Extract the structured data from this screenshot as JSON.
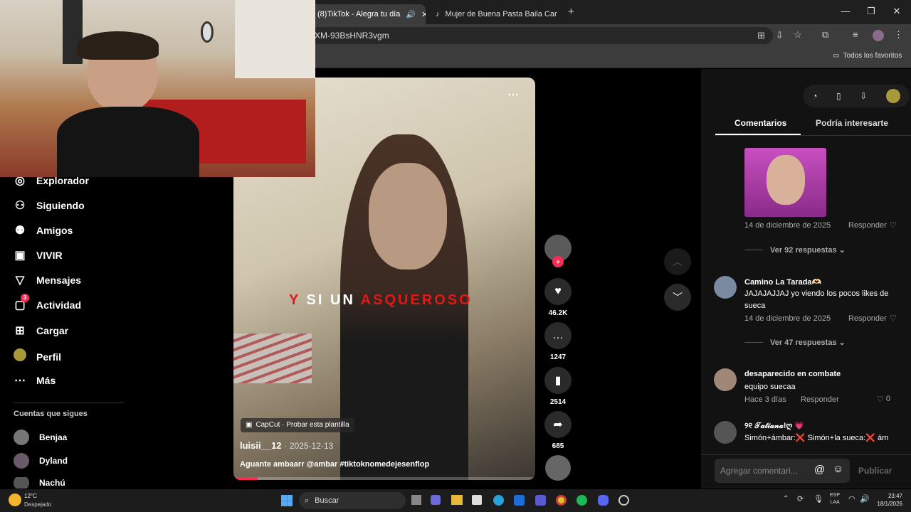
{
  "browser": {
    "tabs": [
      {
        "label": "(8)TikTok - Alegra tu día",
        "active": true
      },
      {
        "label": "Mujer de Buena Pasta Baila Car",
        "active": false
      }
    ],
    "url": "XM-93BsHNR3vgm",
    "bookmarks_label": "Todos los favoritos"
  },
  "sidebar": {
    "items": [
      {
        "label": "Explorador",
        "icon": "compass-icon"
      },
      {
        "label": "Siguiendo",
        "icon": "user-follow-icon"
      },
      {
        "label": "Amigos",
        "icon": "friends-icon"
      },
      {
        "label": "VIVIR",
        "icon": "live-icon"
      },
      {
        "label": "Mensajes",
        "icon": "send-icon"
      },
      {
        "label": "Actividad",
        "icon": "activity-icon",
        "badge": "3"
      },
      {
        "label": "Cargar",
        "icon": "upload-icon"
      },
      {
        "label": "Perfil",
        "icon": "avatar"
      },
      {
        "label": "Más",
        "icon": "more-icon"
      }
    ],
    "following_title": "Cuentas que sigues",
    "following": [
      "Benjaa",
      "Dyland",
      "Nachú"
    ]
  },
  "video": {
    "capcut": "CapCut · Probar esta plantilla",
    "username": "luisii__12",
    "date": "· 2025-12-13",
    "caption": "Aguante ambaarr @ambar #tiktoknomedejesenflop",
    "overlay_text": [
      "Y",
      "SI UN",
      "ASQUEROSO"
    ],
    "progress": 0.08
  },
  "actions": {
    "likes": "46.2K",
    "comments": "1247",
    "saves": "2514",
    "shares": "685"
  },
  "panel": {
    "tabs": [
      "Comentarios",
      "Podría interesarte"
    ],
    "first_comment": {
      "date": "14 de diciembre de 2025",
      "reply": "Responder",
      "more": "Ver 92 respuestas"
    },
    "comments": [
      {
        "user": "Camino La Tarada🫶🏻",
        "text": "JAJAJAJJAJ yo viendo los pocos likes de",
        "text2": "sueca",
        "date": "14 de diciembre de 2025",
        "reply": "Responder",
        "more": "Ver 47 respuestas"
      },
      {
        "user": "desaparecido en combate",
        "text": "equipo suecaa",
        "date": "Hace 3 días",
        "reply": "Responder",
        "likes": "0"
      },
      {
        "user": "୨୧ 𝒯𝒶𝓉𝒾𝒶𝓃𝒶!ღ 💗",
        "text": "Simón+ámbar:❌ Simón+la sueca:❌ ám"
      }
    ],
    "input_placeholder": "Agregar comentari...",
    "publish": "Publicar"
  },
  "taskbar": {
    "weather_temp": "12°C",
    "weather_desc": "Despejado",
    "search": "Buscar",
    "lang1": "ESP",
    "lang2": "LAA",
    "time": "23:47",
    "date": "18/1/2026"
  }
}
